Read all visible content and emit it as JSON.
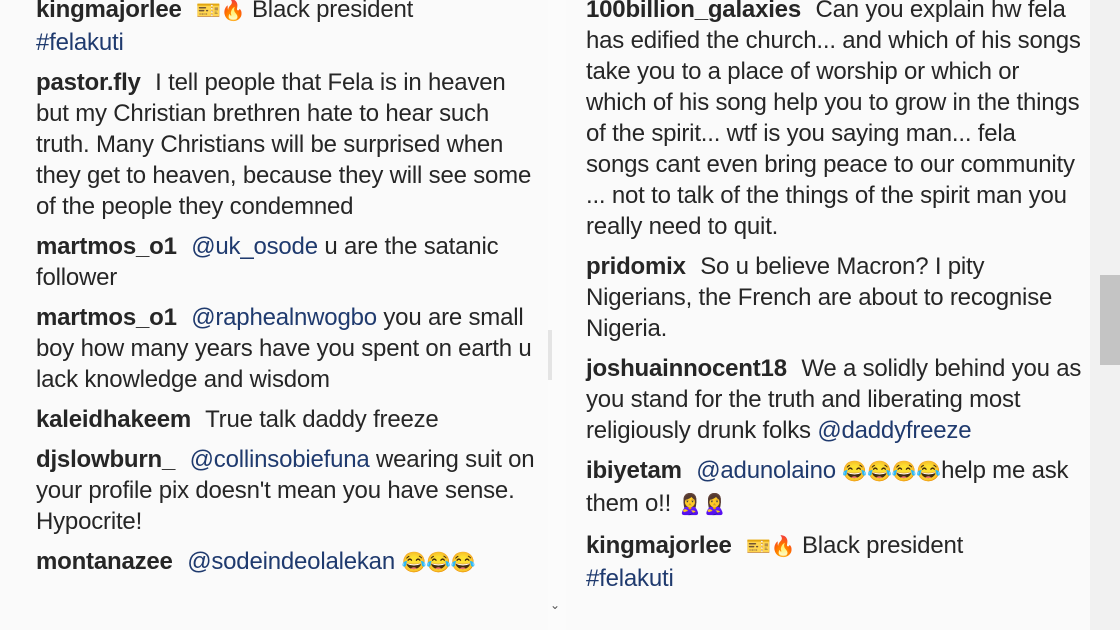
{
  "left": {
    "c0": {
      "user": "kingmajorlee",
      "emoji": "🎫🔥",
      "text": "Black president",
      "tag": "#felakuti"
    },
    "c1": {
      "user": "pastor.fly",
      "text": "I tell people that Fela is in heaven but my Christian brethren hate to hear such truth. Many Christians will be surprised when they get to heaven, because they will see some of the people they condemned"
    },
    "c2": {
      "user": "martmos_o1",
      "mention": "@uk_osode",
      "text": "u are the satanic follower"
    },
    "c3": {
      "user": "martmos_o1",
      "mention": "@raphealnwogbo",
      "text": "you are small boy how many years have you spent on earth u lack knowledge and wisdom"
    },
    "c4": {
      "user": "kaleidhakeem",
      "text": "True talk daddy freeze"
    },
    "c5": {
      "user": "djslowburn_",
      "mention": "@collinsobiefuna",
      "text": "wearing suit on your profile pix doesn't mean you have sense. Hypocrite!"
    },
    "c6": {
      "user": "montanazee",
      "mention": "@sodeindeolalekan",
      "emoji": "😂😂😂"
    }
  },
  "right": {
    "c0": {
      "user": "100billion_galaxies",
      "text": "Can you explain hw fela has edified the church... and which of his songs take you to a place of worship or which or which of his song help you to grow in the things of the spirit... wtf is you saying man... fela songs cant even bring peace to our community ... not to talk of the things of the spirit man you really need to quit."
    },
    "c1": {
      "user": "pridomix",
      "text": "So u believe Macron? I pity Nigerians, the French are about to recognise Nigeria."
    },
    "c2": {
      "user": "joshuainnocent18",
      "text": "We a solidly behind you as you stand for the truth and liberating most religiously drunk folks",
      "mention": "@daddyfreeze"
    },
    "c3": {
      "user": "ibiyetam",
      "mention": "@adunolaino",
      "emoji": "😂😂😂😂",
      "text": "help me ask them o!!",
      "emoji2": "🙎‍♀️🙎‍♀️"
    },
    "c4": {
      "user": "kingmajorlee",
      "emoji": "🎫🔥",
      "text": "Black president",
      "tag": "#felakuti"
    }
  },
  "scroll_arrow": "⌄"
}
